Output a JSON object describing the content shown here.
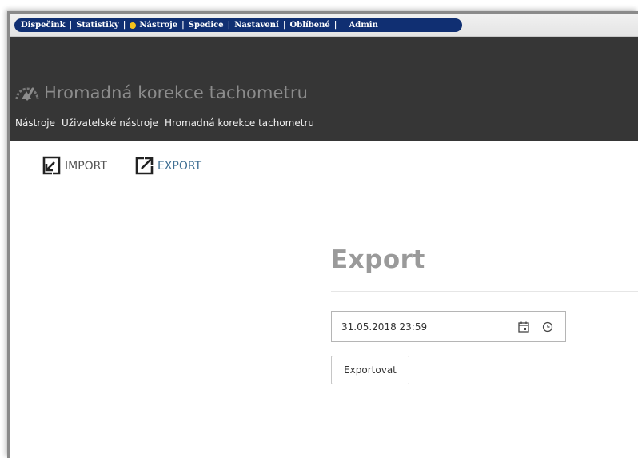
{
  "menu": {
    "items": [
      {
        "label": "Dispečink"
      },
      {
        "label": "Statistiky"
      },
      {
        "label": "Nástroje"
      },
      {
        "label": "Spedice"
      },
      {
        "label": "Nastavení"
      },
      {
        "label": "Oblíbené"
      },
      {
        "label": "Admin"
      }
    ],
    "separator": "|",
    "active_dot_color": "#f4c21b",
    "pill_color": "#102f72"
  },
  "header": {
    "title": "Hromadná korekce tachometru",
    "title_icon": "gauge-icon",
    "breadcrumb": [
      "Nástroje",
      "Uživatelské nástroje",
      "Hromadná korekce tachometru"
    ],
    "background": "#363636"
  },
  "toolbar": {
    "import_label": "IMPORT",
    "import_icon": "import-arrow-icon",
    "export_label": "EXPORT",
    "export_icon": "export-arrow-icon"
  },
  "export_section": {
    "title": "Export",
    "datetime_value": "31.05.2018 23:59",
    "calendar_icon": "calendar-icon",
    "clock_icon": "clock-icon",
    "button_label": "Exportovat"
  }
}
